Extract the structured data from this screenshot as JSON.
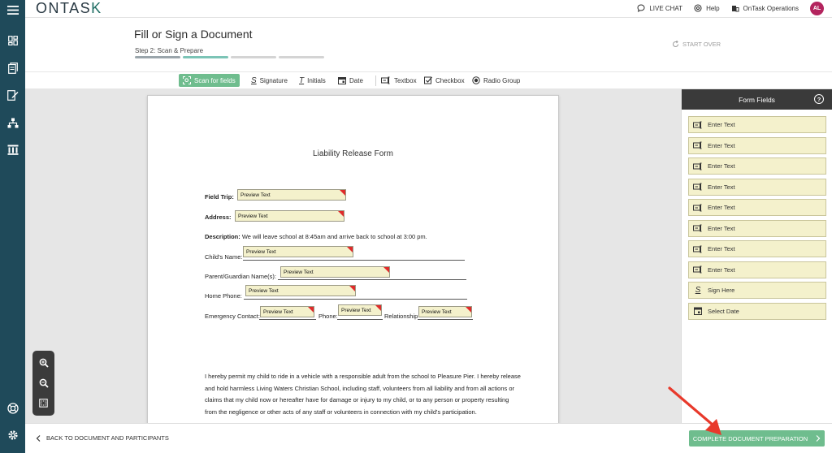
{
  "app": {
    "logo_text": "ONTAS",
    "logo_accent": "K"
  },
  "topbar": {
    "live_chat": "LIVE CHAT",
    "help": "Help",
    "org": "OnTask Operations",
    "avatar_initials": "AL"
  },
  "header": {
    "title": "Fill or Sign a Document",
    "step": "Step 2: Scan & Prepare",
    "start_over": "START OVER"
  },
  "toolbar": {
    "scan": "Scan for fields",
    "signature": "Signature",
    "initials": "Initials",
    "date": "Date",
    "textbox": "Textbox",
    "checkbox": "Checkbox",
    "radio_group": "Radio Group"
  },
  "document": {
    "title": "Liability Release Form",
    "field_trip_label": "Field Trip:",
    "address_label": "Address:",
    "description_label": "Description:",
    "description_text": "We will leave school at 8:45am and arrive back to school at 3:00 pm.",
    "childs_name_label": "Child's Name:",
    "parent_label": "Parent/Guardian Name(s):",
    "home_phone_label": "Home Phone:",
    "emergency_label": "Emergency Contact:",
    "phone_label": "Phone:",
    "relationship_label": "Relationship",
    "preview": "Preview Text",
    "para_lines": [
      "I hereby permit my child to ride in a vehicle with a responsible adult from the school to Pleasure Pier.  I hereby release",
      "and hold harmless Living Waters Christian School, including staff, volunteers from all liability and from all actions or",
      "claims that my child now or hereafter have for damage or injury to my child, or to any person or property resulting",
      "from the negligence or other acts of any staff or volunteers in connection with my child's participation."
    ]
  },
  "panel": {
    "title": "Form Fields",
    "help": "?",
    "items": [
      {
        "label": "Enter Text",
        "icon": "textbox-icon"
      },
      {
        "label": "Enter Text",
        "icon": "textbox-icon"
      },
      {
        "label": "Enter Text",
        "icon": "textbox-icon"
      },
      {
        "label": "Enter Text",
        "icon": "textbox-icon"
      },
      {
        "label": "Enter Text",
        "icon": "textbox-icon"
      },
      {
        "label": "Enter Text",
        "icon": "textbox-icon"
      },
      {
        "label": "Enter Text",
        "icon": "textbox-icon"
      },
      {
        "label": "Enter Text",
        "icon": "textbox-icon"
      },
      {
        "label": "Sign Here",
        "icon": "signature-icon"
      },
      {
        "label": "Select Date",
        "icon": "calendar-icon"
      }
    ]
  },
  "bottombar": {
    "back": "BACK TO DOCUMENT AND PARTICIPANTS",
    "complete": "COMPLETE DOCUMENT PREPARATION"
  },
  "colors": {
    "rail": "#1f4a5a",
    "accent_green": "#6fbd8e",
    "field_fill": "#f4f1cc",
    "field_corner": "#e02b2b",
    "annotation_arrow": "#e8392b"
  }
}
